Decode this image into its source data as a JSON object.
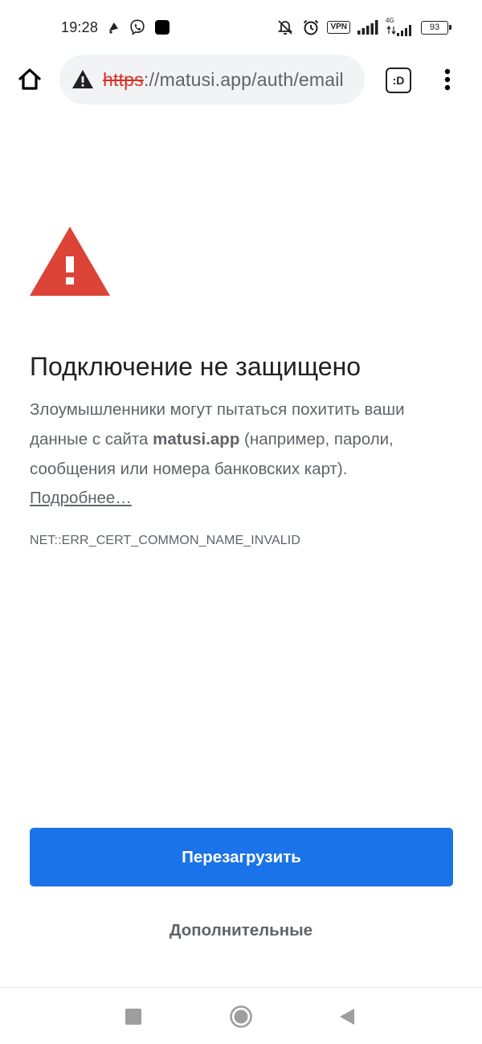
{
  "status_bar": {
    "time": "19:28",
    "vpn_label": "VPN",
    "network_type": "4G",
    "battery_level": "93",
    "icons": [
      "notification-bell-icon",
      "viber-icon",
      "app-square-icon",
      "mute-icon",
      "alarm-icon",
      "vpn-icon",
      "signal-icon",
      "signal-4g-icon",
      "battery-icon"
    ]
  },
  "toolbar": {
    "url_scheme": "https",
    "url_separator": "://",
    "url_rest": "matusi.app/auth/email",
    "tab_switcher_label": ":D",
    "icons": [
      "home-icon",
      "warning-triangle-icon",
      "more-vert-icon"
    ]
  },
  "interstitial": {
    "heading": "Подключение не защищено",
    "body_prefix": "Злоумышленники могут пытаться похитить ваши данные с сайта ",
    "body_host": "matusi.app",
    "body_suffix": " (например, пароли, сообщения или номера банковских карт).",
    "learn_more": "Подробнее…",
    "error_code": "NET::ERR_CERT_COMMON_NAME_INVALID",
    "reload_button": "Перезагрузить",
    "advanced_button": "Дополнительные"
  },
  "colors": {
    "warning_red": "#db4437",
    "scheme_red": "#d93025",
    "primary_blue": "#1a73e8",
    "text_primary": "#202124",
    "text_secondary": "#5f6368",
    "omnibox_bg": "#f1f3f4"
  },
  "nav_bar": {
    "icons": [
      "recents-square-icon",
      "home-circle-icon",
      "back-triangle-icon"
    ]
  }
}
